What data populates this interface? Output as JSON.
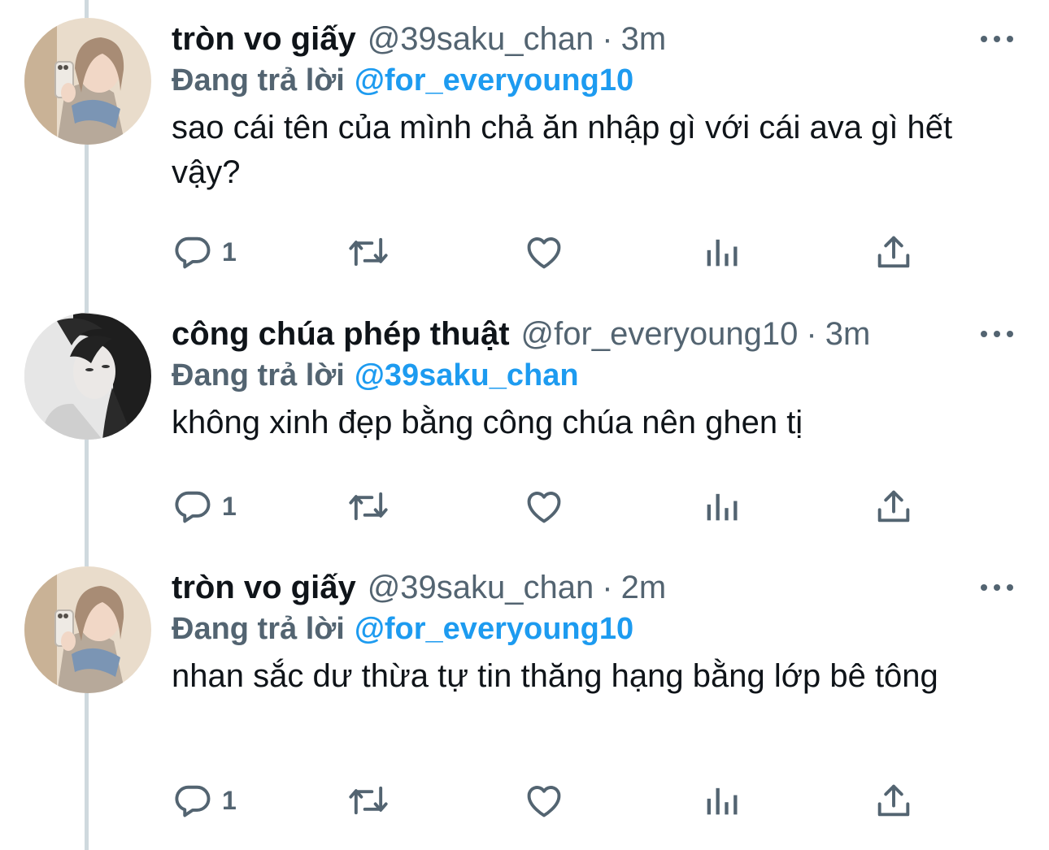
{
  "tweets": [
    {
      "name": "tròn vo giấy",
      "handle": "@39saku_chan",
      "separator": "·",
      "time": "3m",
      "replying_label": "Đang trả lời",
      "replying_to": "@for_everyoung10",
      "text": "sao cái tên của mình chả ăn nhập gì với cái ava gì hết vậy?",
      "reply_count": "1"
    },
    {
      "name": "công chúa phép thuật",
      "handle": "@for_everyoung10",
      "separator": "·",
      "time": "3m",
      "replying_label": "Đang trả lời",
      "replying_to": "@39saku_chan",
      "text": "không xinh đẹp bằng công chúa nên ghen tị",
      "reply_count": "1"
    },
    {
      "name": "tròn vo giấy",
      "handle": "@39saku_chan",
      "separator": "·",
      "time": "2m",
      "replying_label": "Đang trả lời",
      "replying_to": "@for_everyoung10",
      "text": "nhan sắc dư thừa tự tin thăng hạng bằng lớp bê tông",
      "reply_count": "1"
    }
  ],
  "icons": {
    "reply": "reply-icon",
    "retweet": "retweet-icon",
    "like": "heart-icon",
    "views": "views-icon",
    "share": "share-icon",
    "more": "more-icon"
  },
  "colors": {
    "text": "#0f1419",
    "secondary": "#536471",
    "accent": "#1d9bf0",
    "thread_line": "#cfd9de"
  }
}
